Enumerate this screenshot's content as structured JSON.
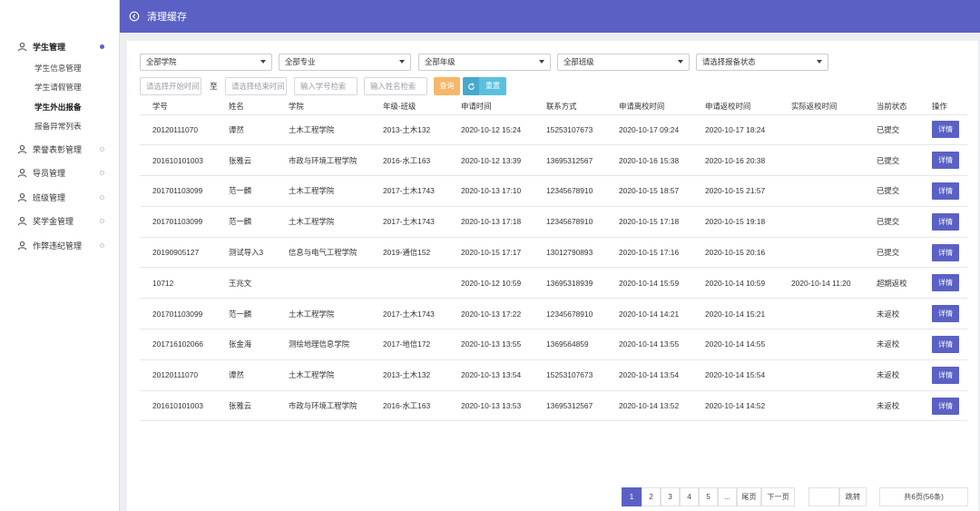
{
  "header": {
    "title": "清理缓存"
  },
  "sidebar": {
    "groups": [
      {
        "label": "学生管理",
        "open": true
      },
      {
        "label": "荣誉表彰管理"
      },
      {
        "label": "导员管理"
      },
      {
        "label": "班级管理"
      },
      {
        "label": "奖学金管理"
      },
      {
        "label": "作弊违纪管理"
      }
    ],
    "subitems": [
      "学生信息管理",
      "学生请假管理",
      "学生外出报备",
      "报备异常列表"
    ]
  },
  "filters": {
    "college": "全部学院",
    "major": "全部专业",
    "grade": "全部年级",
    "class": "全部班级",
    "status": "请选择报备状态",
    "start_placeholder": "请选择开始时间",
    "to_label": "至",
    "end_placeholder": "请选择结束时间",
    "id_placeholder": "输入学号检索",
    "name_placeholder": "输入姓名检索",
    "query_label": "查询",
    "reset_label": "重置"
  },
  "table": {
    "headers": [
      "学号",
      "姓名",
      "学院",
      "年级-班级",
      "申请时间",
      "联系方式",
      "申请离校时间",
      "申请返校时间",
      "实际返校时间",
      "当前状态",
      "操作"
    ],
    "detail_label": "详情",
    "rows": [
      [
        "20120111070",
        "谭然",
        "土木工程学院",
        "2013-土木132",
        "2020-10-12 15:24",
        "15253107673",
        "2020-10-17 09:24",
        "2020-10-17 18:24",
        "",
        "已提交"
      ],
      [
        "201610101003",
        "张雅云",
        "市政与环境工程学院",
        "2016-水工163",
        "2020-10-12 13:39",
        "13695312567",
        "2020-10-16 15:38",
        "2020-10-16 20:38",
        "",
        "已提交"
      ],
      [
        "201701103099",
        "范一麟",
        "土木工程学院",
        "2017-土木1743",
        "2020-10-13 17:10",
        "12345678910",
        "2020-10-15 18:57",
        "2020-10-15 21:57",
        "",
        "已提交"
      ],
      [
        "201701103099",
        "范一麟",
        "土木工程学院",
        "2017-土木1743",
        "2020-10-13 17:18",
        "12345678910",
        "2020-10-15 17:18",
        "2020-10-15 19:18",
        "",
        "已提交"
      ],
      [
        "20190905127",
        "测试导入3",
        "信息与电气工程学院",
        "2019-通信152",
        "2020-10-15 17:17",
        "13012790893",
        "2020-10-15 17:16",
        "2020-10-15 20:16",
        "",
        "已提交"
      ],
      [
        "10712",
        "王兆文",
        "",
        "",
        "2020-10-12 10:59",
        "13695318939",
        "2020-10-14 15:59",
        "2020-10-14 10:59",
        "2020-10-14 11:20",
        "超期返校"
      ],
      [
        "201701103099",
        "范一麟",
        "土木工程学院",
        "2017-土木1743",
        "2020-10-13 17:22",
        "12345678910",
        "2020-10-14 14:21",
        "2020-10-14 15:21",
        "",
        "未返校"
      ],
      [
        "201716102066",
        "张金海",
        "测绘地理信息学院",
        "2017-地信172",
        "2020-10-13 13:55",
        "1369564859",
        "2020-10-14 13:55",
        "2020-10-14 14:55",
        "",
        "未返校"
      ],
      [
        "20120111070",
        "谭然",
        "土木工程学院",
        "2013-土木132",
        "2020-10-13 13:54",
        "15253107673",
        "2020-10-14 13:54",
        "2020-10-14 15:54",
        "",
        "未返校"
      ],
      [
        "201610101003",
        "张雅云",
        "市政与环境工程学院",
        "2016-水工163",
        "2020-10-13 13:53",
        "13695312567",
        "2020-10-14 13:52",
        "2020-10-14 14:52",
        "",
        "未返校"
      ]
    ]
  },
  "pagination": {
    "pages": [
      "1",
      "2",
      "3",
      "4",
      "5",
      "..."
    ],
    "last_label": "尾页",
    "next_label": "下一页",
    "jump_label": "跳转",
    "summary": "共6页(56条)"
  },
  "colors": {
    "accent": "#5b61c4",
    "query": "#f5b76a",
    "reset": "#5bc0de"
  }
}
